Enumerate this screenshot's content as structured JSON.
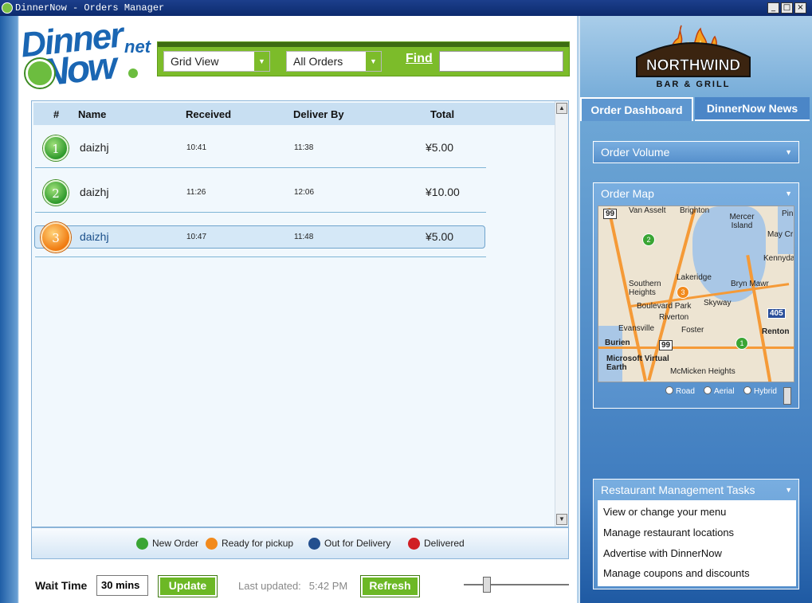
{
  "window": {
    "title": "DinnerNow - Orders Manager",
    "minimize_glyph": "_",
    "maximize_glyph": "□",
    "close_glyph": "×"
  },
  "logo": {
    "line1": "Dinner",
    "line2": "Now",
    "suffix": "net"
  },
  "toolbar": {
    "view_selected": "Grid View",
    "filter_selected": "All Orders",
    "find_label": "Find",
    "find_value": ""
  },
  "grid": {
    "columns": [
      "#",
      "Name",
      "Received",
      "Deliver By",
      "Total"
    ],
    "rows": [
      {
        "num": "1",
        "name": "daizhj",
        "received": "10:41",
        "deliver_by": "11:38",
        "total": "¥5.00",
        "status": "new"
      },
      {
        "num": "2",
        "name": "daizhj",
        "received": "11:26",
        "deliver_by": "12:06",
        "total": "¥10.00",
        "status": "new"
      },
      {
        "num": "3",
        "name": "daizhj",
        "received": "10:47",
        "deliver_by": "11:48",
        "total": "¥5.00",
        "status": "ready"
      }
    ]
  },
  "legend": [
    {
      "label": "New Order",
      "color": "#3aa534"
    },
    {
      "label": "Ready for pickup",
      "color": "#f28a1d"
    },
    {
      "label": "Out for Delivery",
      "color": "#234f8e"
    },
    {
      "label": "Delivered",
      "color": "#d01f24"
    }
  ],
  "bottom": {
    "wait_label": "Wait Time",
    "wait_value": "30 mins",
    "update_label": "Update",
    "last_updated_label": "Last updated:",
    "last_updated_time": "5:42 PM",
    "refresh_label": "Refresh"
  },
  "brand": {
    "name": "NORTHWIND",
    "sub": "BAR & GRILL"
  },
  "tabs": [
    {
      "label": "Order Dashboard",
      "active": true
    },
    {
      "label": "DinnerNow News",
      "active": false
    }
  ],
  "panels": {
    "order_volume": "Order Volume",
    "order_map": "Order Map",
    "tasks_title": "Restaurant Management Tasks"
  },
  "map": {
    "labels": [
      "Van Asselt",
      "Brighton",
      "Mercer Island",
      "May Cr",
      "Kennydale",
      "Southern Heights",
      "Lakeridge",
      "Bryn Mawr",
      "Boulevard Park",
      "Skyway",
      "Riverton",
      "Evansville",
      "Foster",
      "Renton",
      "Burien",
      "Microsoft Virtual Earth",
      "McMicken Heights",
      "Pin"
    ],
    "shields": [
      "99",
      "99",
      "405"
    ],
    "pins": [
      {
        "num": "2",
        "color": "#3aa534"
      },
      {
        "num": "3",
        "color": "#f28a1d"
      },
      {
        "num": "1",
        "color": "#3aa534"
      }
    ],
    "modes": [
      "Road",
      "Aerial",
      "Hybrid"
    ]
  },
  "tasks": [
    "View or change your menu",
    "Manage restaurant locations",
    "Advertise with DinnerNow",
    "Manage coupons and discounts"
  ]
}
